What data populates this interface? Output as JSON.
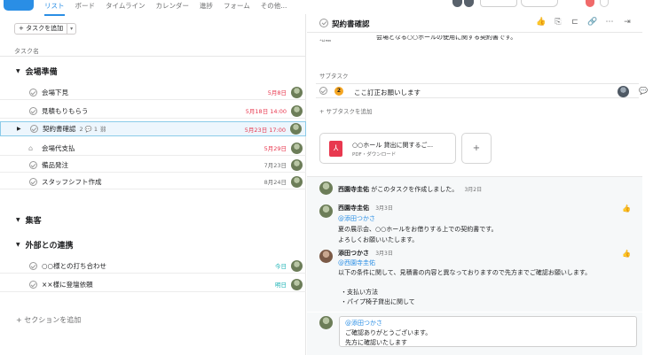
{
  "nav": {
    "tabs": [
      "リスト",
      "ボード",
      "タイムライン",
      "カレンダー",
      "進捗",
      "フォーム",
      "その他..."
    ],
    "active_index": 0
  },
  "list": {
    "add_task_label": "+ タスクを追加",
    "column_task_name": "タスク名",
    "add_section_label": "+ セクションを追加",
    "sections": [
      {
        "name": "会場準備",
        "tasks": [
          {
            "name": "会場下見",
            "due": "5月8日",
            "due_color": "red"
          },
          {
            "name": "見積もりもらう",
            "due": "5月18日 14:00",
            "due_color": "red"
          },
          {
            "name": "契約書確認",
            "meta": "2 💬 1 ⛓",
            "due": "5月23日 17:00",
            "due_color": "red",
            "selected": true
          },
          {
            "name": "会場代支払",
            "due": "5月29日",
            "due_color": "red",
            "milestone": true
          },
          {
            "name": "備品発注",
            "due": "7月23日",
            "due_color": "gray"
          },
          {
            "name": "スタッフシフト作成",
            "due": "8月24日",
            "due_color": "gray"
          }
        ]
      },
      {
        "name": "集客",
        "tasks": []
      },
      {
        "name": "外部との連携",
        "tasks": [
          {
            "name": "○○様との打ち合わせ",
            "due": "今日",
            "due_color": "teal"
          },
          {
            "name": "××様に登壇依頼",
            "due": "明日",
            "due_color": "teal"
          }
        ]
      }
    ]
  },
  "detail": {
    "title": "契約書確認",
    "description_label": "説明",
    "description_text": "会場となる○○ホールの使用に関する契約書です。",
    "subtask_label": "サブタスク",
    "subtask": {
      "badge": "2",
      "text": "ここ訂正お願いします"
    },
    "add_subtask_label": "+ サブタスクを追加",
    "attachment": {
      "name": "○○ホール 貸出に関するご...",
      "sub": "PDF・ダウンロード"
    },
    "activity": {
      "created": {
        "name": "西園寺圭佑",
        "text": "がこのタスクを作成しました。",
        "date": "3月2日"
      },
      "comments": [
        {
          "name": "西園寺圭佑",
          "date": "3月3日",
          "mention": "@添田つかさ",
          "lines": [
            "夏の展示会、○○ホールをお借りする上での契約書です。",
            "よろしくお願いいたします。"
          ]
        },
        {
          "name": "添田つかさ",
          "date": "3月3日",
          "mention": "@西園寺圭佑",
          "lines": [
            "以下の条件に関して、見積書の内容と異なっておりますので先方までご確認お願いします。",
            "",
            "・支払い方法",
            "・パイプ椅子貸出に関して"
          ]
        }
      ]
    },
    "comment_draft": {
      "mention": "@添田つかさ",
      "lines": [
        "ご確認ありがとうございます。",
        "先方に確認いたします"
      ]
    }
  }
}
